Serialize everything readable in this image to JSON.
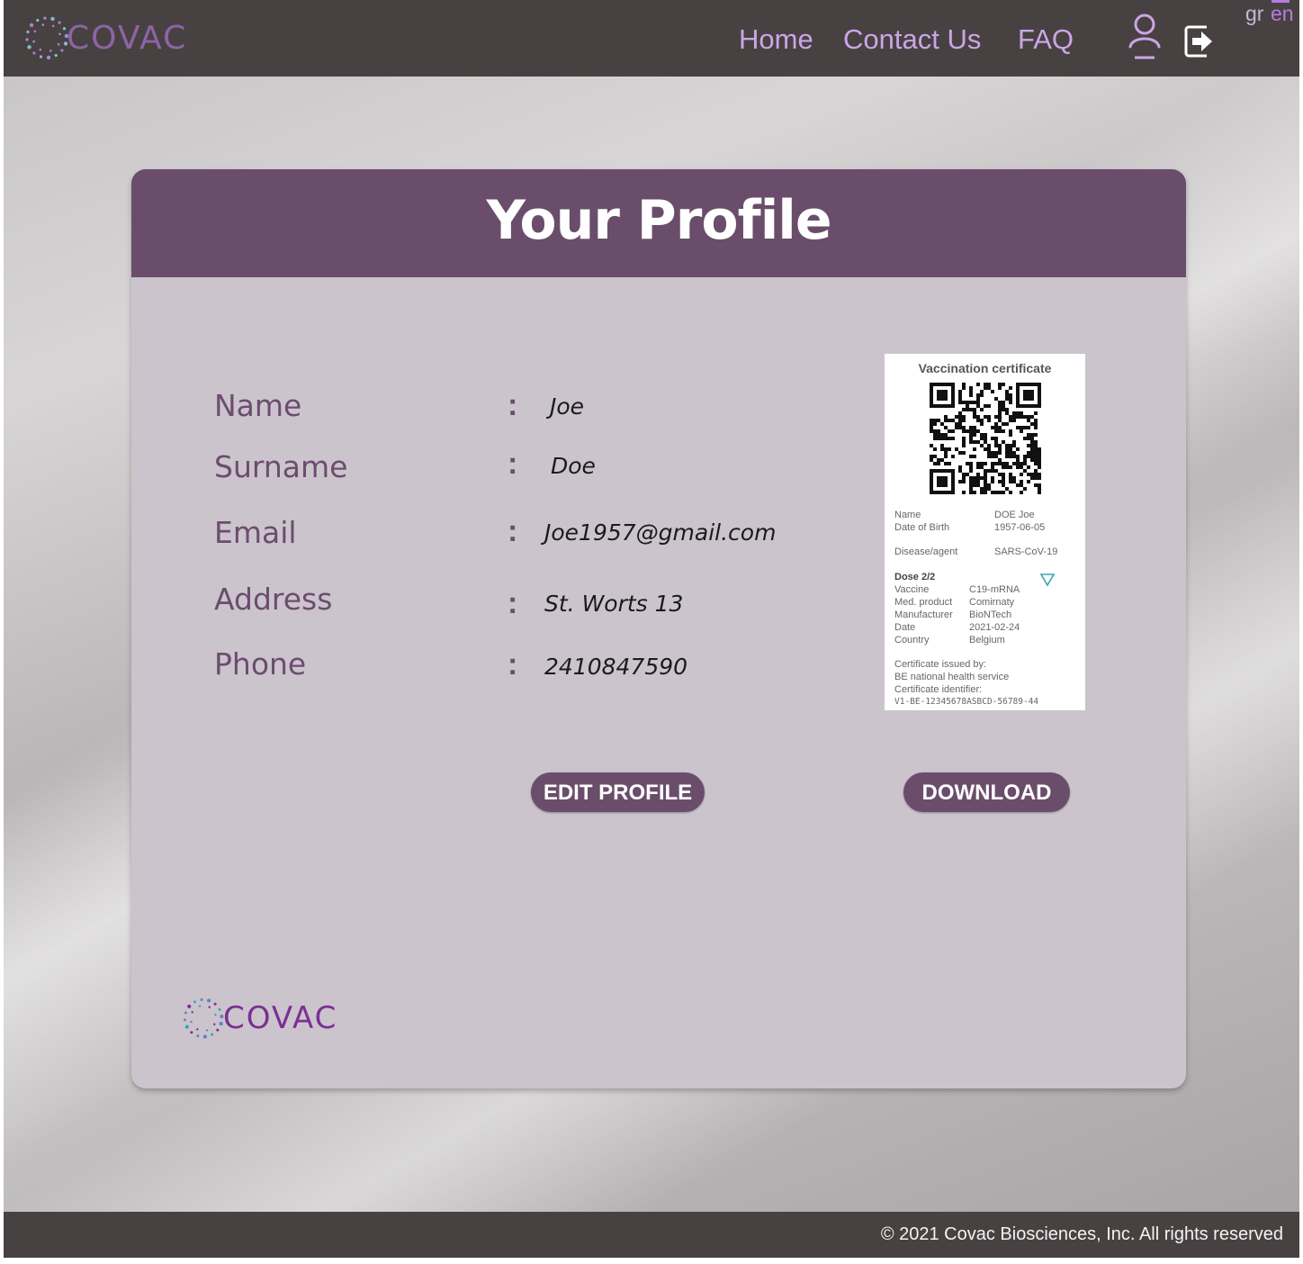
{
  "header": {
    "brand": "COVAC",
    "nav": {
      "home": "Home",
      "contact": "Contact Us",
      "faq": "FAQ"
    },
    "languages": {
      "gr": "gr",
      "en": "en"
    },
    "active_language": "en",
    "icons": {
      "profile": "user-icon",
      "logout": "logout-icon"
    }
  },
  "card": {
    "title": "Your Profile",
    "fields": [
      {
        "label": "Name",
        "value": "Joe"
      },
      {
        "label": "Surname",
        "value": "Doe"
      },
      {
        "label": "Email",
        "value": "Joe1957@gmail.com"
      },
      {
        "label": "Address",
        "value": "St. Worts 13"
      },
      {
        "label": "Phone",
        "value": "2410847590"
      }
    ],
    "separator": ":",
    "edit_button": "EDIT PROFILE",
    "download_button": "DOWNLOAD",
    "footer_brand": "COVAC"
  },
  "certificate": {
    "title": "Vaccination certificate",
    "name_label": "Name",
    "name_value": "DOE Joe",
    "dob_label": "Date of Birth",
    "dob_value": "1957-06-05",
    "disease_label": "Disease/agent",
    "disease_value": "SARS-CoV-19",
    "dose": "Dose 2/2",
    "vaccine_label": "Vaccine",
    "vaccine_value": "C19-mRNA",
    "product_label": "Med. product",
    "product_value": "Comirnaty",
    "manufacturer_label": "Manufacturer",
    "manufacturer_value": "BioNTech",
    "date_label": "Date",
    "date_value": "2021-02-24",
    "country_label": "Country",
    "country_value": "Belgium",
    "issued_by_label": "Certificate issued by:",
    "issued_by_value": "BE national health service",
    "identifier_label": "Certificate identifier:",
    "identifier_value": "V1-BE-12345678ASBCD-56789-44"
  },
  "footer": {
    "copyright": "© 2021 Covac Biosciences, Inc. All rights reserved"
  },
  "colors": {
    "header_bg": "#484142",
    "accent_purple": "#6a4d6b",
    "nav_link": "#caa6e6",
    "card_bg": "#cbc4cd"
  }
}
